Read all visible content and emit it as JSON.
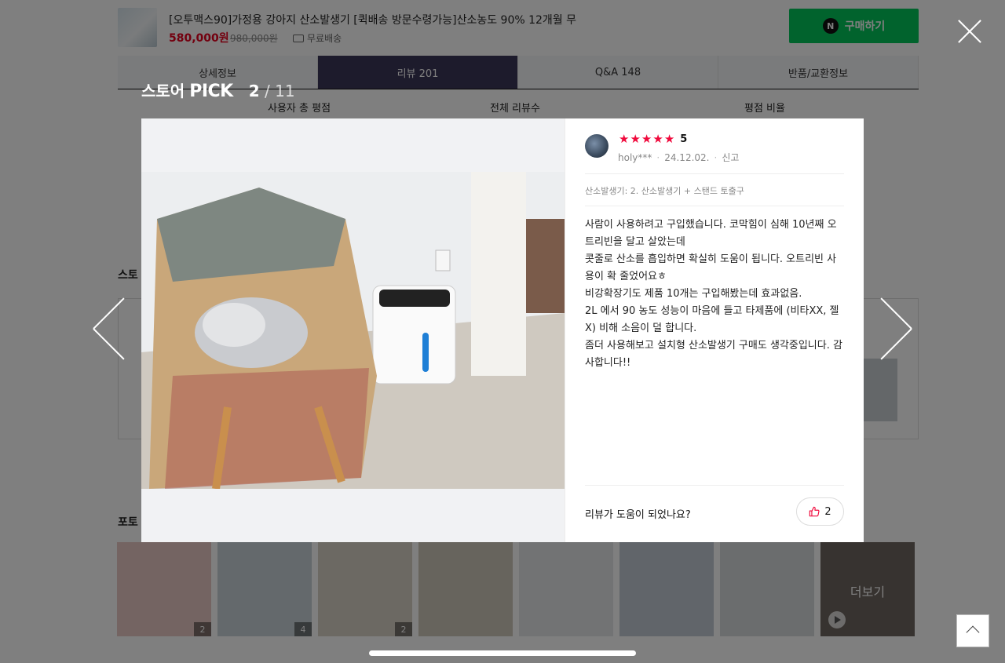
{
  "product": {
    "title": "[오투맥스90]가정용 강아지 산소발생기 [퀵배송 방문수령가능]산소농도 90% 12개월 무",
    "price": "580,000원",
    "original_price": "980,000원",
    "shipping": "무료배송",
    "buy_label": "구매하기",
    "naver_badge": "N"
  },
  "tabs": [
    {
      "label": "상세정보"
    },
    {
      "label": "리뷰 201"
    },
    {
      "label": "Q&A 148"
    },
    {
      "label": "반품/교환정보"
    }
  ],
  "rating_summary": {
    "total_score_label": "사용자 총 평점",
    "total_reviews_label": "전체 리뷰수",
    "score_ratio_label": "평점 비율"
  },
  "sections": {
    "store_pick_partial": "스토",
    "photo_partial": "포토"
  },
  "photo_strip": [
    {
      "count": "2"
    },
    {
      "count": "4"
    },
    {
      "count": "2"
    },
    {
      "count": ""
    },
    {
      "count": ""
    },
    {
      "count": ""
    },
    {
      "count": ""
    },
    {
      "count": "",
      "more_label": "더보기"
    }
  ],
  "modal": {
    "title_store": "스토어",
    "title_pick": "PICK",
    "current": "2",
    "total": "/ 11",
    "review": {
      "score": "5",
      "star_count": 5,
      "star_color": "#f0093c",
      "author": "holy***",
      "date": "24.12.02.",
      "report": "신고",
      "option": "산소발생기: 2. 산소발생기 + 스탠드 토출구",
      "paragraphs": [
        "사람이 사용하려고 구입했습니다. 코막힘이 심해 10년째 오트리빈을 달고 살았는데",
        "콧줄로 산소를 흡입하면 확실히 도움이 됩니다. 오트리빈 사용이 확 줄었어요ㅎ",
        "비강확장기도 제품 10개는 구입해봤는데 효과없음.",
        "2L 에서 90 농도 성능이 마음에 들고 타제품에 (비타XX, 젤X) 비해 소음이 덜 합니다.",
        "좀더 사용해보고 설치형 산소발생기 구매도 생각중입니다. 감사합니다!!"
      ],
      "helpful_question": "리뷰가 도움이 되었나요?",
      "like_count": "2"
    }
  },
  "colors": {
    "accent_green": "#03c75a",
    "price_red": "#e6001e",
    "active_tab": "#3b3658"
  }
}
